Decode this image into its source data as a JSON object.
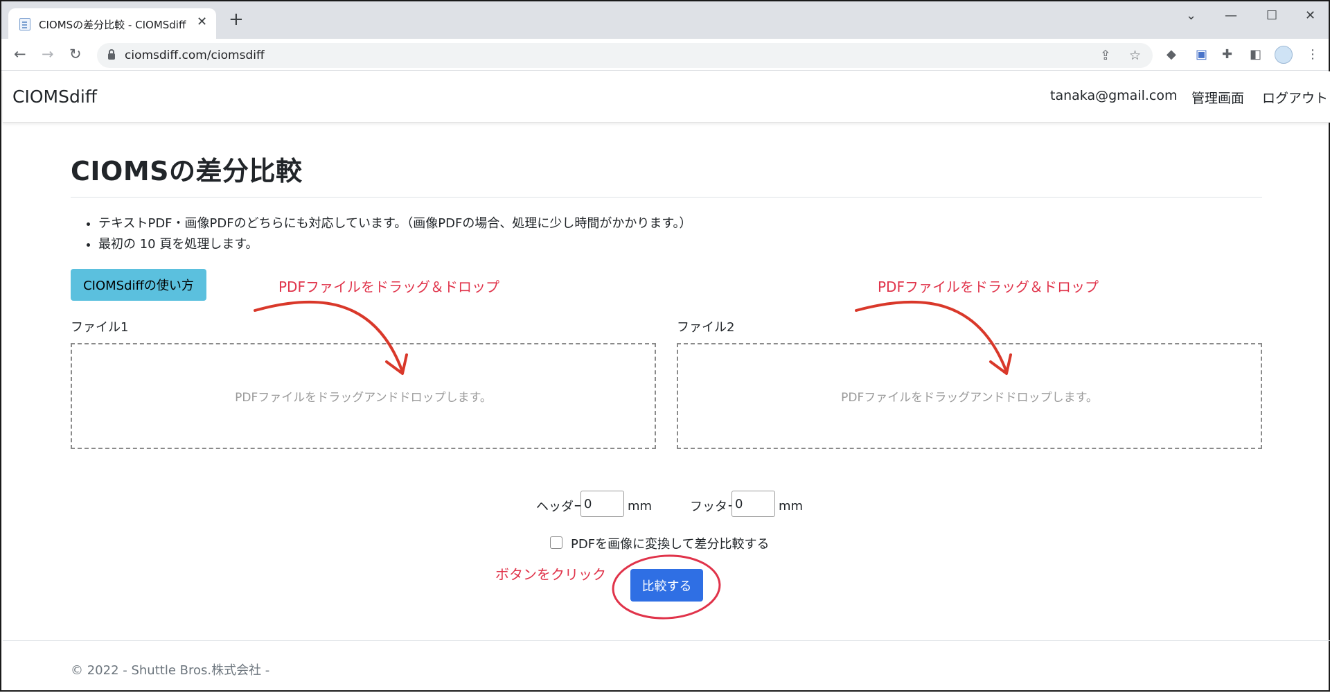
{
  "browser": {
    "tab_title": "CIOMSの差分比較 - CIOMSdiff",
    "url": "ciomsdiff.com/ciomsdiff"
  },
  "navbar": {
    "brand": "CIOMSdiff",
    "user_email": "tanaka@gmail.com",
    "admin_link": "管理画面",
    "logout_link": "ログアウト"
  },
  "main": {
    "title": "CIOMSの差分比較",
    "bullets": [
      "テキストPDF・画像PDFのどちらにも対応しています。（画像PDFの場合、処理に少し時間がかかります。）",
      "最初の 10 頁を処理します。"
    ],
    "help_button": "CIOMSdiffの使い方",
    "file1_label": "ファイル1",
    "file2_label": "ファイル2",
    "dropzone_text": "PDFファイルをドラッグアンドドロップします。",
    "header_label": "ヘッダー",
    "header_value": "0",
    "footer_label": "フッター",
    "footer_value": "0",
    "unit": "mm",
    "convert_checkbox_label": "PDFを画像に変換して差分比較する",
    "convert_checked": false,
    "compare_button": "比較する"
  },
  "annotations": {
    "drag_drop": "PDFファイルをドラッグ＆ドロップ",
    "click_button": "ボタンをクリック"
  },
  "footer": {
    "copyright": "© 2022 - Shuttle Bros.株式会社 -"
  },
  "colors": {
    "annotation": "#e0334a",
    "help_button": "#5bc0de",
    "compare_button": "#2f6fe4"
  }
}
